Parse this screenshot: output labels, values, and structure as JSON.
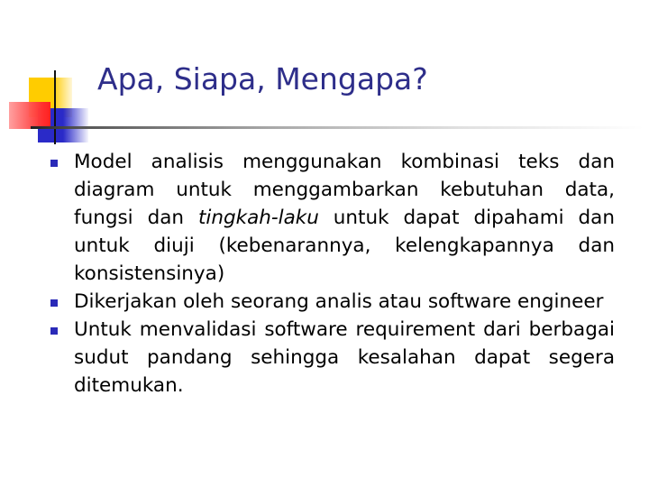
{
  "slide": {
    "title": "Apa, Siapa, Mengapa?",
    "accent_color": "#2e2e8a",
    "bullets": [
      {
        "before": "Model analisis menggunakan kombinasi teks dan diagram untuk menggambarkan kebutuhan data, fungsi dan ",
        "emphasis": "tingkah-laku",
        "after": " untuk dapat dipahami dan untuk diuji (kebenarannya, kelengkapannya dan konsistensinya)"
      },
      {
        "before": "Dikerjakan oleh seorang analis atau software engineer",
        "emphasis": "",
        "after": ""
      },
      {
        "before": "Untuk menvalidasi software requirement dari berbagai sudut pandang sehingga kesalahan dapat segera ditemukan.",
        "emphasis": "",
        "after": ""
      }
    ]
  }
}
